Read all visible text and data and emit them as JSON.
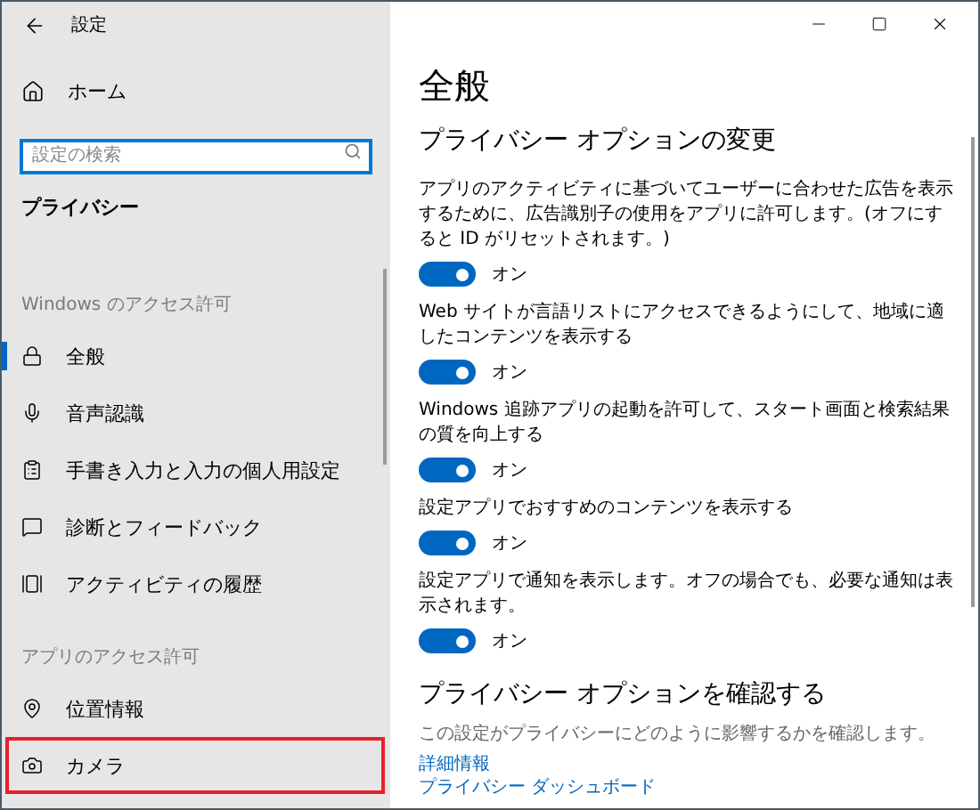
{
  "window": {
    "title": "設定"
  },
  "sidebar": {
    "home": "ホーム",
    "search": {
      "placeholder": "設定の検索"
    },
    "section_title": "プライバシー",
    "groups": [
      {
        "heading": "Windows のアクセス許可",
        "items": [
          {
            "label": "全般",
            "selected": true,
            "highlighted": false
          },
          {
            "label": "音声認識",
            "selected": false,
            "highlighted": false
          },
          {
            "label": "手書き入力と入力の個人用設定",
            "selected": false,
            "highlighted": false
          },
          {
            "label": "診断とフィードバック",
            "selected": false,
            "highlighted": false
          },
          {
            "label": "アクティビティの履歴",
            "selected": false,
            "highlighted": false
          }
        ]
      },
      {
        "heading": "アプリのアクセス許可",
        "items": [
          {
            "label": "位置情報",
            "selected": false,
            "highlighted": false
          },
          {
            "label": "カメラ",
            "selected": false,
            "highlighted": true
          }
        ]
      }
    ]
  },
  "content": {
    "title": "全般",
    "subtitle": "プライバシー オプションの変更",
    "settings": [
      {
        "description": "アプリのアクティビティに基づいてユーザーに合わせた広告を表示するために、広告識別子の使用をアプリに許可します。(オフにすると ID がリセットされます。)",
        "on": true,
        "state_label": "オン"
      },
      {
        "description": "Web サイトが言語リストにアクセスできるようにして、地域に適したコンテンツを表示する",
        "on": true,
        "state_label": "オン"
      },
      {
        "description": "Windows 追跡アプリの起動を許可して、スタート画面と検索結果の質を向上する",
        "on": true,
        "state_label": "オン"
      },
      {
        "description": "設定アプリでおすすめのコンテンツを表示する",
        "on": true,
        "state_label": "オン"
      },
      {
        "description": "設定アプリで通知を表示します。オフの場合でも、必要な通知は表示されます。",
        "on": true,
        "state_label": "オン"
      }
    ],
    "review": {
      "title": "プライバシー オプションを確認する",
      "description": "この設定がプライバシーにどのように影響するかを確認します。",
      "links": [
        "詳細情報",
        "プライバシー ダッシュボード"
      ]
    }
  }
}
